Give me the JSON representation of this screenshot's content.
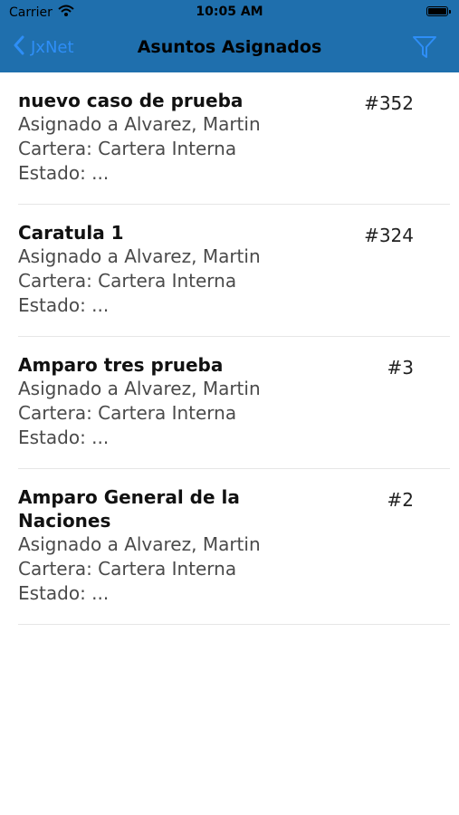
{
  "status_bar": {
    "carrier": "Carrier",
    "time": "10:05 AM"
  },
  "nav": {
    "back_label": "JxNet",
    "title": "Asuntos Asignados"
  },
  "colors": {
    "bar": "#1f6fad",
    "accent": "#2e8ef7"
  },
  "items": [
    {
      "title": "nuevo caso de prueba",
      "number": "#352",
      "assigned": "Asignado a Alvarez, Martin",
      "cartera": "Cartera: Cartera Interna",
      "estado": "Estado: ..."
    },
    {
      "title": "Caratula 1",
      "number": "#324",
      "assigned": "Asignado a Alvarez, Martin",
      "cartera": "Cartera: Cartera Interna",
      "estado": "Estado: ..."
    },
    {
      "title": "Amparo tres prueba",
      "number": "#3",
      "assigned": "Asignado a Alvarez, Martin",
      "cartera": "Cartera: Cartera Interna",
      "estado": "Estado: ..."
    },
    {
      "title": "Amparo General de la Naciones",
      "number": "#2",
      "assigned": "Asignado a Alvarez, Martin",
      "cartera": "Cartera: Cartera Interna",
      "estado": "Estado: ..."
    }
  ]
}
